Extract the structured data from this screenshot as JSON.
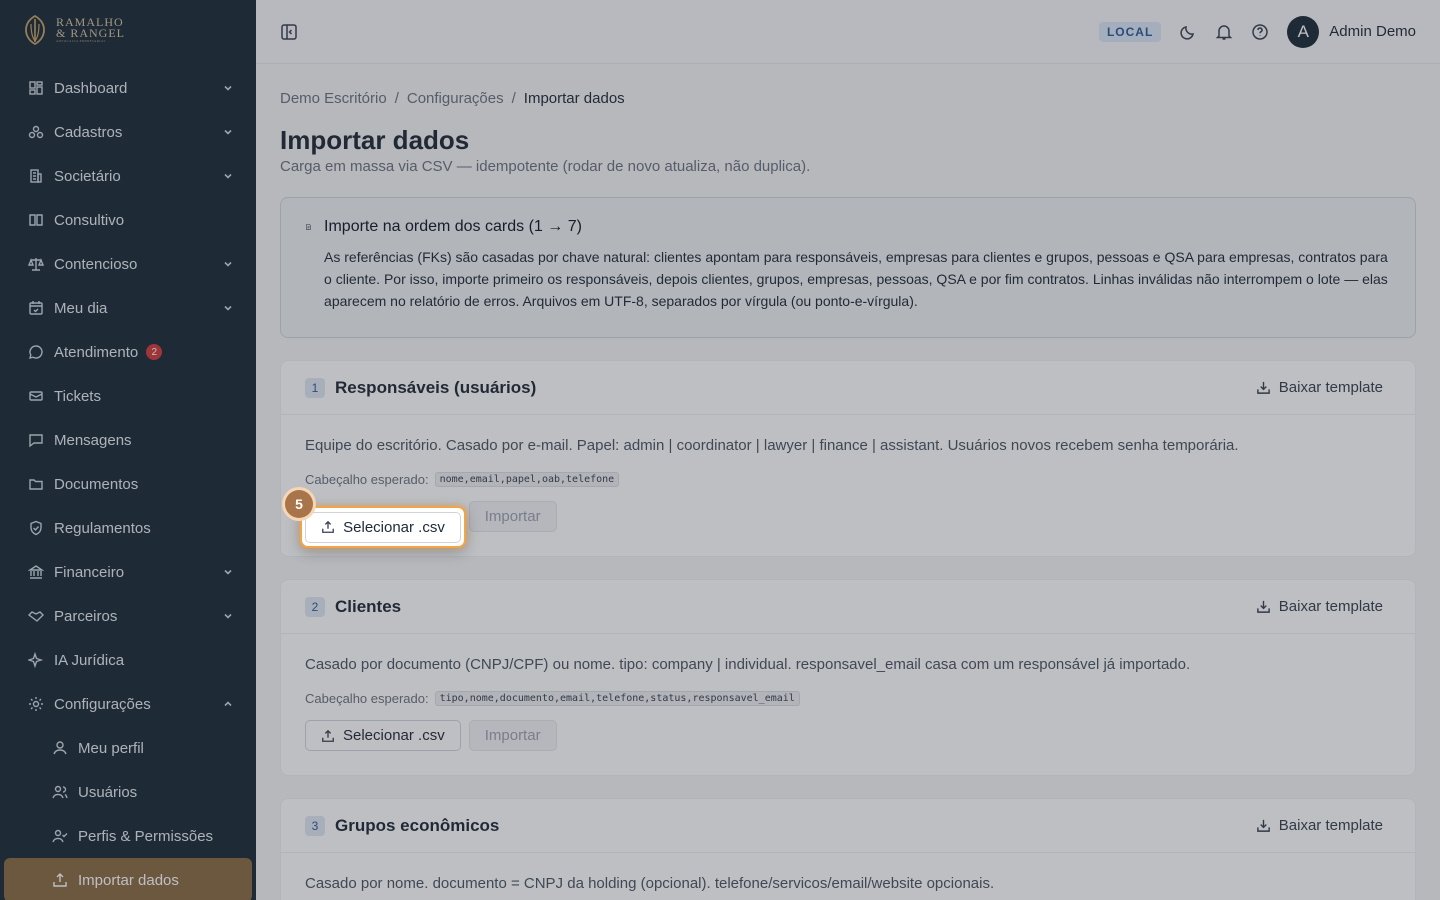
{
  "brand": {
    "line1": "RAMALHO",
    "line2": "& RANGEL",
    "tagline": "ADVOCACIA EMPRESARIAL"
  },
  "sidebar": {
    "items": [
      {
        "label": "Dashboard",
        "icon": "dashboard-icon",
        "expandable": true
      },
      {
        "label": "Cadastros",
        "icon": "cadastros-icon",
        "expandable": true
      },
      {
        "label": "Societário",
        "icon": "building-icon",
        "expandable": true
      },
      {
        "label": "Consultivo",
        "icon": "book-icon",
        "expandable": false
      },
      {
        "label": "Contencioso",
        "icon": "scale-icon",
        "expandable": true
      },
      {
        "label": "Meu dia",
        "icon": "calendar-icon",
        "expandable": true
      },
      {
        "label": "Atendimento",
        "icon": "chat-icon",
        "expandable": false,
        "badge": "2"
      },
      {
        "label": "Tickets",
        "icon": "ticket-icon",
        "expandable": false
      },
      {
        "label": "Mensagens",
        "icon": "message-icon",
        "expandable": false
      },
      {
        "label": "Documentos",
        "icon": "folder-icon",
        "expandable": false
      },
      {
        "label": "Regulamentos",
        "icon": "shield-icon",
        "expandable": false
      },
      {
        "label": "Financeiro",
        "icon": "bank-icon",
        "expandable": true
      },
      {
        "label": "Parceiros",
        "icon": "handshake-icon",
        "expandable": true
      },
      {
        "label": "IA Jurídica",
        "icon": "sparkle-icon",
        "expandable": false
      },
      {
        "label": "Configurações",
        "icon": "gear-icon",
        "expandable": true,
        "expanded": true
      }
    ],
    "subitems": [
      {
        "label": "Meu perfil",
        "icon": "user-icon"
      },
      {
        "label": "Usuários",
        "icon": "users-icon"
      },
      {
        "label": "Perfis & Permissões",
        "icon": "user-check-icon"
      },
      {
        "label": "Importar dados",
        "icon": "upload-icon",
        "active": true
      }
    ]
  },
  "topbar": {
    "env": "LOCAL",
    "avatar_letter": "A",
    "user_name": "Admin Demo"
  },
  "breadcrumb": [
    "Demo Escritório",
    "/",
    "Configurações",
    "/",
    "Importar dados"
  ],
  "page": {
    "title": "Importar dados",
    "subtitle": "Carga em massa via CSV — idempotente (rodar de novo atualiza, não duplica)."
  },
  "notice": {
    "title": "Importe na ordem dos cards (1 → 7)",
    "body": "As referências (FKs) são casadas por chave natural: clientes apontam para responsáveis, empresas para clientes e grupos, pessoas e QSA para empresas, contratos para o cliente. Por isso, importe primeiro os responsáveis, depois clientes, grupos, empresas, pessoas, QSA e por fim contratos. Linhas inválidas não interrompem o lote — elas aparecem no relatório de erros. Arquivos em UTF-8, separados por vírgula (ou ponto-e-vírgula)."
  },
  "cards": [
    {
      "num": "1",
      "title": "Responsáveis (usuários)",
      "download": "Baixar template",
      "desc": "Equipe do escritório. Casado por e-mail. Papel: admin | coordinator | lawyer | finance | assistant. Usuários novos recebem senha temporária.",
      "header_label": "Cabeçalho esperado:",
      "header_code": "nome,email,papel,oab,telefone",
      "select_label": "Selecionar .csv",
      "import_label": "Importar"
    },
    {
      "num": "2",
      "title": "Clientes",
      "download": "Baixar template",
      "desc": "Casado por documento (CNPJ/CPF) ou nome. tipo: company | individual. responsavel_email casa com um responsável já importado.",
      "header_label": "Cabeçalho esperado:",
      "header_code": "tipo,nome,documento,email,telefone,status,responsavel_email",
      "select_label": "Selecionar .csv",
      "import_label": "Importar"
    },
    {
      "num": "3",
      "title": "Grupos econômicos",
      "download": "Baixar template",
      "desc": "Casado por nome. documento = CNPJ da holding (opcional). telefone/servicos/email/website opcionais."
    }
  ],
  "tour": {
    "step": "5"
  }
}
